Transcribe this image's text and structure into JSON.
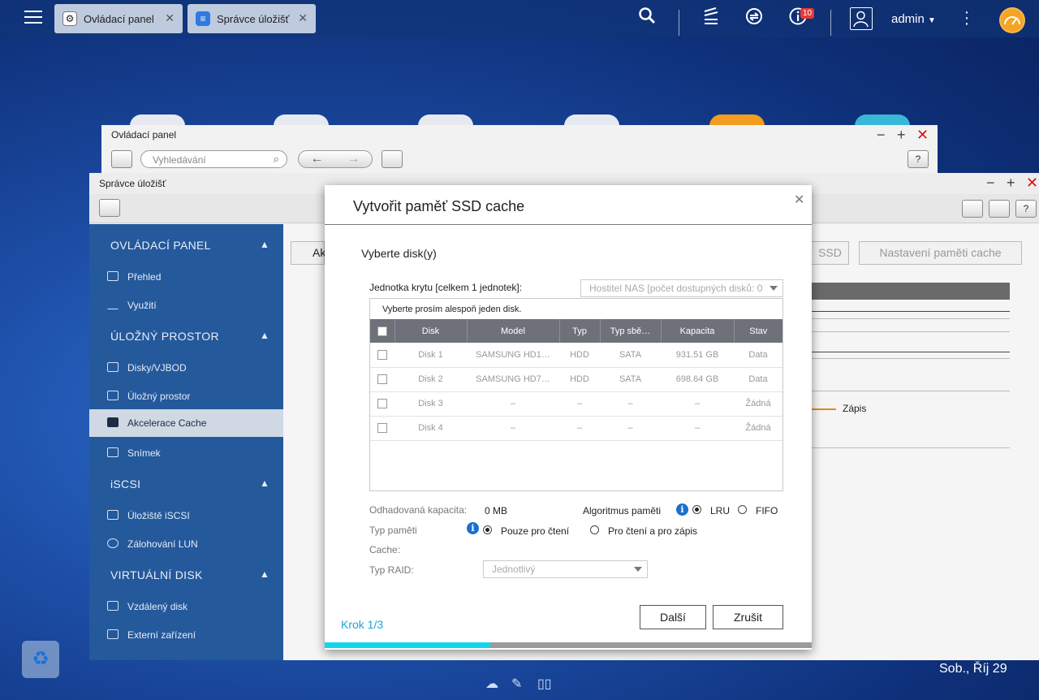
{
  "taskbar": {
    "tabs": [
      {
        "label": "Ovládací panel",
        "icon": "gear-icon"
      },
      {
        "label": "Správce úložišť",
        "icon": "database-icon"
      }
    ],
    "notification_count": "10",
    "user": "admin"
  },
  "control_panel_window": {
    "title": "Ovládací panel",
    "search_placeholder": "Vyhledávání",
    "help": "?"
  },
  "storage_window": {
    "title": "Správce úložišť",
    "tabs": [
      "Ak",
      "SSD",
      "Nastavení paměti cache"
    ],
    "legend_write": "Zápis",
    "sidebar": [
      {
        "header": "OVLÁDACÍ PANEL",
        "items": [
          "Přehled",
          "Využití"
        ]
      },
      {
        "header": "ÚLOŽNÝ PROSTOR",
        "items": [
          "Disky/VJBOD",
          "Úložný prostor",
          "Akcelerace Cache",
          "Snímek"
        ]
      },
      {
        "header": "iSCSI",
        "items": [
          "Úložiště iSCSI",
          "Zálohování LUN"
        ]
      },
      {
        "header": "VIRTUÁLNÍ DISK",
        "items": [
          "Vzdálený disk",
          "Externí zařízení"
        ]
      }
    ],
    "active_item": "Akcelerace Cache"
  },
  "modal": {
    "title": "Vytvořit paměť SSD cache",
    "section_title": "Vyberte disk(y)",
    "enclosure_label": "Jednotka krytu [celkem 1 jednotek]:",
    "enclosure_value": "Hostitel NAS [počet dostupných disků: 0",
    "note": "Vyberte prosím alespoň jeden disk.",
    "columns": [
      "Disk",
      "Model",
      "Typ",
      "Typ sbě…",
      "Kapacita",
      "Stav"
    ],
    "rows": [
      [
        "Disk 1",
        "SAMSUNG HD1…",
        "HDD",
        "SATA",
        "931.51 GB",
        "Data"
      ],
      [
        "Disk 2",
        "SAMSUNG HD7…",
        "HDD",
        "SATA",
        "698.64 GB",
        "Data"
      ],
      [
        "Disk 3",
        "–",
        "–",
        "–",
        "–",
        "Žádná"
      ],
      [
        "Disk 4",
        "–",
        "–",
        "–",
        "–",
        "Žádná"
      ]
    ],
    "capacity_label": "Odhadovaná kapacita:",
    "capacity_value": "0 MB",
    "algorithm_label": "Algoritmus paměti",
    "algorithm_options": [
      "LRU",
      "FIFO"
    ],
    "memory_type_label": "Typ paměti",
    "cache_label": "Cache:",
    "memory_type_options": [
      "Pouze pro čtení",
      "Pro čtení a pro zápis"
    ],
    "raid_label": "Typ RAID:",
    "raid_value": "Jednotlivý",
    "next": "Další",
    "cancel": "Zrušit",
    "step": "Krok 1/3",
    "progress": 0.34
  },
  "clock": "Sob., Říj 29",
  "colors": {
    "accent": "#1ba3d8",
    "progress": "#12d6f0",
    "sidebar": "#24599c"
  }
}
